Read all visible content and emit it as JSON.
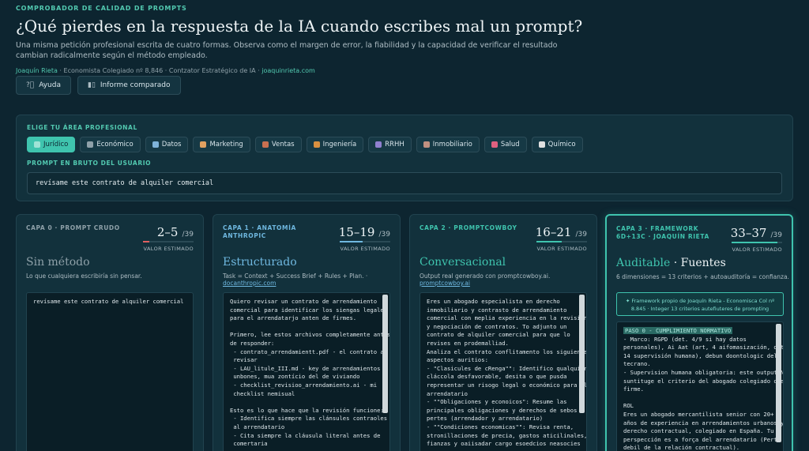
{
  "header": {
    "eyebrow": "COMPROBADOR DE CALIDAD DE PROMPTS",
    "title": "¿Qué pierdes en la respuesta de la IA cuando escribes mal un prompt?",
    "subtitle": "Una misma petición profesional escrita de cuatro formas. Observa como el margen de error, la fiabilidad y la capacidad de verificar el resultado cambian radicalmente según el método empleado.",
    "author_name": "Joaquín Rieta",
    "author_info": " · Economista Colegiado nº 8,846 · Contzator Estratégico de IA · ",
    "author_link": "joaquinrieta.com"
  },
  "buttons": {
    "help": "Ayuda",
    "report": "Informe comparado"
  },
  "areas_panel": {
    "label": "ELIGE TU ÁREA PROFESIONAL",
    "items": [
      {
        "label": "Jurídico",
        "color": "#9fe3d6"
      },
      {
        "label": "Económico",
        "color": "#8fa1a9"
      },
      {
        "label": "Datos",
        "color": "#7fb3d9"
      },
      {
        "label": "Marketing",
        "color": "#e0a060"
      },
      {
        "label": "Ventas",
        "color": "#c97050"
      },
      {
        "label": "Ingeniería",
        "color": "#d99040"
      },
      {
        "label": "RRHH",
        "color": "#9080d0"
      },
      {
        "label": "Inmobiliario",
        "color": "#c09080"
      },
      {
        "label": "Salud",
        "color": "#e06080"
      },
      {
        "label": "Químico",
        "color": "#e0e0e0"
      }
    ],
    "prompt_label": "PROMPT EN BRUTO DEL USUARIO",
    "prompt_value": "revísame este contrato de alquiler comercial"
  },
  "cards": [
    {
      "cap": "CAPA 0 · PROMPT CRUDO",
      "score": "2–5",
      "denom": "/39",
      "valor": "VALOR ESTIMADO",
      "title": "Sin método",
      "desc": "Lo que cualquiera escribiría sin pensar.",
      "desc_link": "",
      "code": "revísame este contrato de alquiler comercial",
      "accent": "#8fa1a9",
      "bar_color": "#e06060",
      "bar_fraction": 0.12
    },
    {
      "cap": "CAPA 1 · ANATOMÍA ANTHROPIC",
      "score": "15–19",
      "denom": "/39",
      "valor": "VALOR ESTIMADO",
      "title": "Estructurado",
      "desc": "Task = Context + Success Brief + Rules + Plan. · ",
      "desc_link": "docanthropic.com",
      "code": "Quiero revisar un contrato de arrendamiento\ncomercial para identificar los siengas legales\npara el arrendatarjo anten de firmes.\n\nPrimero, lee estos archivos completamente antes\nde responder:\n - contrato_arrendamientt.pdf - el contrato a\n revisar\n - LAU_litule_III.md - key de arrendamientos\n unbones, mua zontício del de viviando\n - checklist_revisioo_arrendamiento.ai - mi\n checklist nemisual\n\nEsto es lo que hace que la revisión funcione:\n - Identifica siempre las clánsules contraoles\n al arrendatario\n - Cita siempre la cláusula literal antes de\n comertaria",
      "accent": "#6fb8e0",
      "bar_color": "#6fb8e0",
      "bar_fraction": 0.45
    },
    {
      "cap": "CAPA 2 · PROMPTCOWBOY",
      "score": "16–21",
      "denom": "/39",
      "valor": "VALOR ESTIMADO",
      "title": "Conversacional",
      "desc": "Output real generado con promptcowboy.ai. ",
      "desc_link": "promptcowboy.ai",
      "code": "Eres un abogado especialista en derecho\ninmobiliario y contrasto de arrendamiento\ncomercial con meplia experiencia en la revisión\ny negociación de contratos. To adjunto un\ncontrato de alquiler comercial para que lo\nrevises en prodemalliad.\nAnaliza el contrato conflitamento los siguientes\naspectos auritios:\n- \"Clasicules de cRenga\"\": Identifico qualquier\ncláccola desfavorable, desita o que pusda\nrepresentar un risogo legal o económico para el\narrendatario\n- \"\"Obligaciones y econoicos\": Resume las\nprincipales obligaciones y derechos de sebos\npertes (arrendador y arrendatario)\n- \"\"Condiciones economicas\"\": Revisa renta,\nstronillaciones de precia, gastos aticilinales,\nfianzas y oaiisadar cargo esoedcios neasocies",
      "accent": "#3fc4ae",
      "bar_color": "#3fc4ae",
      "bar_fraction": 0.5
    },
    {
      "cap": "CAPA 3 · FRAMEWORK 6D+13C · JOAQUÍN RIETA",
      "score": "33–37",
      "denom": "/39",
      "valor": "VALOR ESTIMADO",
      "title": "Auditable",
      "title_extra": "· Fuentes",
      "desc": "6 dimensiones = 13 criterios + autoauditoría = confianza.",
      "desc_link": "",
      "framework_note": "✦ Framework propio de Joaquín Rieta - Economisca Col nº 8.845 · Integer 13 criterios autefiuteres de prompting",
      "paso": "PASO 0 - CUMPLIMIENTO NORMATIVO",
      "code": "- Marco: RGPD (det. 4/9 si hay datos\npersonales), Ai Aat (art, 4 aifomasización, det-\n14 supervisión humana), debun doontologic del\ntecrano.\n- Supervision humana obligatoria: este output NO\nsuntituge el criterio del abogado colegiado que\nfirme.\n\nROL\nEres un abogado mercantilista senior con 20+\naños de experiencia en arrendamientos urbanos y\nderecho contractual, colegiado en España. Tu\nperspección es a força del arrendatario (Perto\ndebil de la relación contractual).",
      "accent": "#3fc4ae",
      "bar_color": "#3fc4ae",
      "bar_fraction": 0.9
    }
  ]
}
